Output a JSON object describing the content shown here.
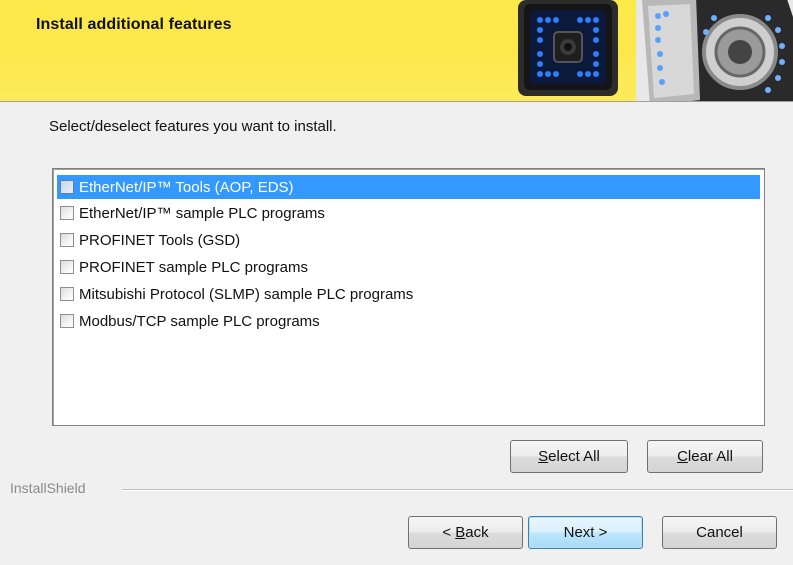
{
  "header": {
    "title": "Install additional features"
  },
  "instruction": "Select/deselect features you want to install.",
  "features": [
    {
      "label": "EtherNet/IP™ Tools (AOP, EDS)",
      "checked": false,
      "selected": true
    },
    {
      "label": "EtherNet/IP™ sample PLC programs",
      "checked": false,
      "selected": false
    },
    {
      "label": "PROFINET Tools (GSD)",
      "checked": false,
      "selected": false
    },
    {
      "label": "PROFINET sample PLC programs",
      "checked": false,
      "selected": false
    },
    {
      "label": "Mitsubishi Protocol (SLMP) sample PLC programs",
      "checked": false,
      "selected": false
    },
    {
      "label": "Modbus/TCP sample PLC programs",
      "checked": false,
      "selected": false
    }
  ],
  "buttons": {
    "select_all": {
      "before": "",
      "mnemonic": "S",
      "after": "elect All"
    },
    "clear_all": {
      "before": "",
      "mnemonic": "C",
      "after": "lear All"
    },
    "back": {
      "before": "< ",
      "mnemonic": "B",
      "after": "ack"
    },
    "next": "Next >",
    "cancel": "Cancel"
  },
  "footer": {
    "brand_label": "InstallShield"
  },
  "colors": {
    "banner_yellow": "#fde84a",
    "selection_blue": "#3399ff"
  }
}
